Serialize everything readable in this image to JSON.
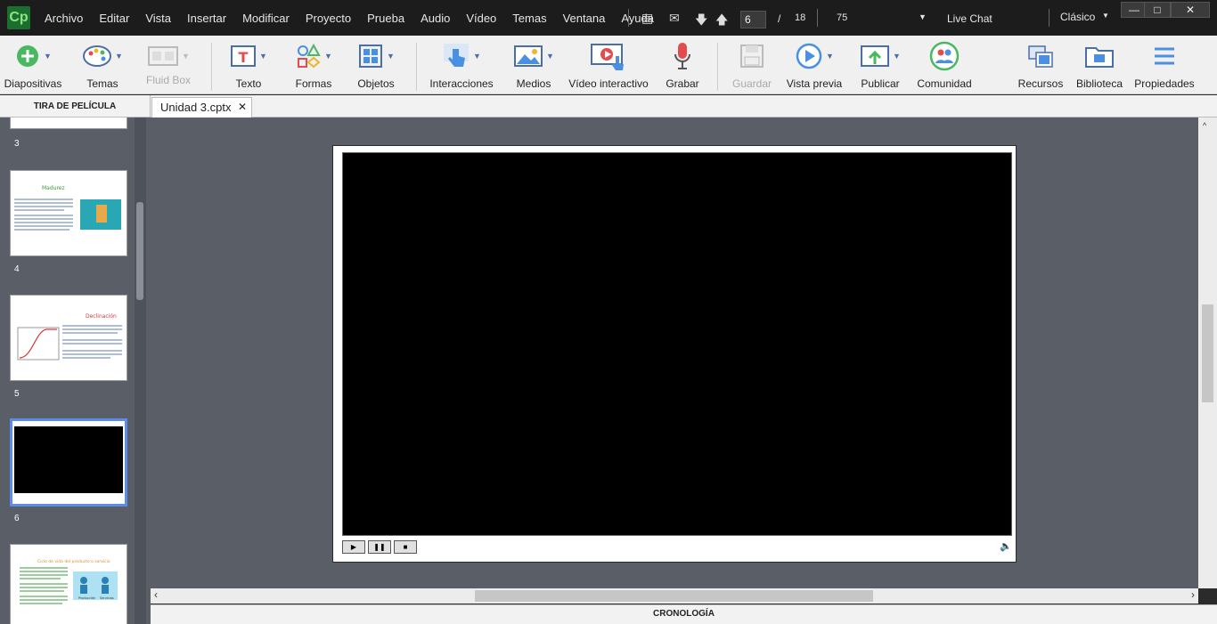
{
  "app": {
    "logo": "Cp"
  },
  "menu": [
    "Archivo",
    "Editar",
    "Vista",
    "Insertar",
    "Modificar",
    "Proyecto",
    "Prueba",
    "Audio",
    "Vídeo",
    "Temas",
    "Ventana",
    "Ayuda"
  ],
  "nav": {
    "current_page": "6",
    "separator": "/",
    "total_pages": "18",
    "zoom": "75",
    "live_chat": "Live Chat",
    "workspace": "Clásico"
  },
  "toolbar": [
    {
      "label": "Diapositivas",
      "icon": "add-slide-icon"
    },
    {
      "label": "Temas",
      "icon": "palette-icon"
    },
    {
      "label": "Fluid Box",
      "icon": "fluid-box-icon",
      "disabled": true
    },
    {
      "label": "Texto",
      "icon": "text-icon"
    },
    {
      "label": "Formas",
      "icon": "shapes-icon"
    },
    {
      "label": "Objetos",
      "icon": "objects-icon"
    },
    {
      "label": "Interacciones",
      "icon": "hand-pointer-icon"
    },
    {
      "label": "Medios",
      "icon": "image-icon"
    },
    {
      "label": "Vídeo interactivo",
      "icon": "interactive-video-icon"
    },
    {
      "label": "Grabar",
      "icon": "microphone-icon"
    },
    {
      "label": "Guardar",
      "icon": "save-icon",
      "disabled": true
    },
    {
      "label": "Vista previa",
      "icon": "play-circle-icon"
    },
    {
      "label": "Publicar",
      "icon": "publish-icon"
    },
    {
      "label": "Comunidad",
      "icon": "community-icon"
    },
    {
      "label": "Recursos",
      "icon": "assets-icon"
    },
    {
      "label": "Biblioteca",
      "icon": "library-icon"
    },
    {
      "label": "Propiedades",
      "icon": "properties-icon"
    }
  ],
  "panels": {
    "filmstrip_title": "TIRA DE PELÍCULA",
    "doc_tab": "Unidad 3.cptx",
    "timeline_title": "CRONOLOGÍA"
  },
  "slides": [
    {
      "number": "3"
    },
    {
      "number": "4",
      "title": "Madurez"
    },
    {
      "number": "5",
      "title": "Declinación"
    },
    {
      "number": "6",
      "selected": true
    },
    {
      "number": "",
      "title": "Ciclo de vida del producto o servicio",
      "caption_left": "Producción",
      "caption_right": "Servicios"
    }
  ],
  "colors": {
    "accent": "#5b8ce6",
    "stage": "#5a5e66",
    "titlebar": "#1c1c1c"
  }
}
